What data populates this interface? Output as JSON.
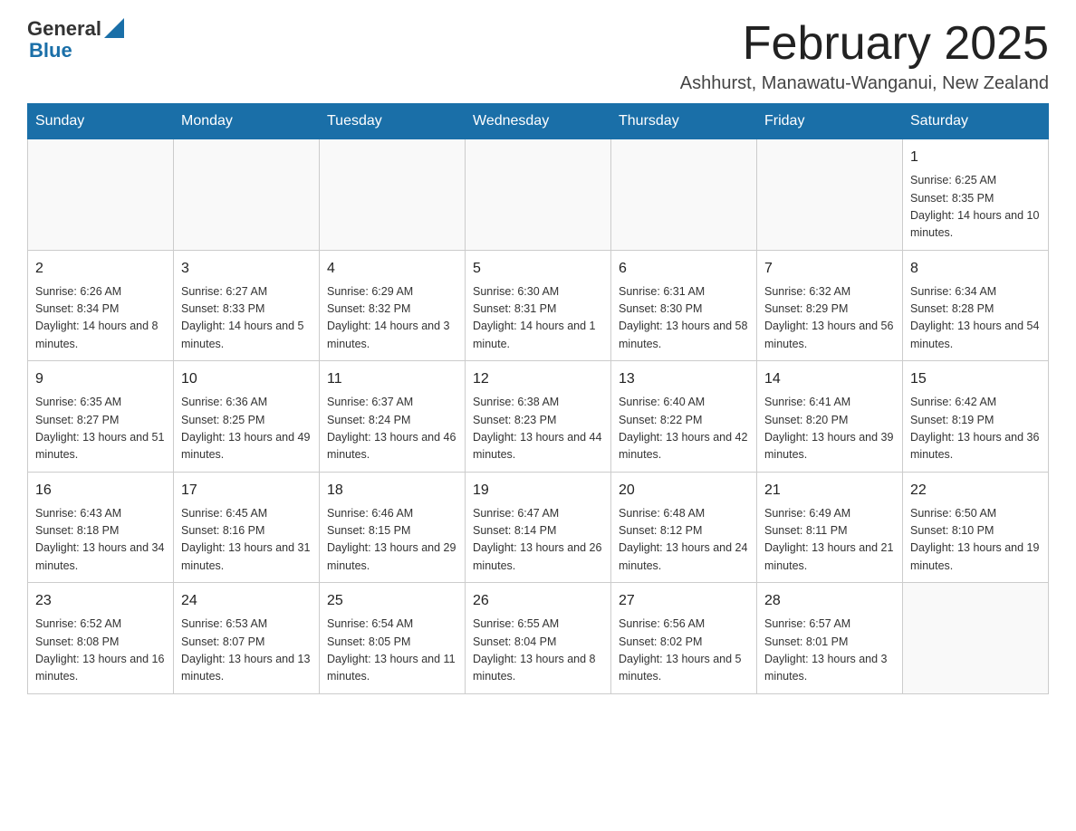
{
  "header": {
    "logo_general": "General",
    "logo_blue": "Blue",
    "title": "February 2025",
    "subtitle": "Ashhurst, Manawatu-Wanganui, New Zealand"
  },
  "days_of_week": [
    "Sunday",
    "Monday",
    "Tuesday",
    "Wednesday",
    "Thursday",
    "Friday",
    "Saturday"
  ],
  "weeks": [
    [
      {
        "day": "",
        "info": ""
      },
      {
        "day": "",
        "info": ""
      },
      {
        "day": "",
        "info": ""
      },
      {
        "day": "",
        "info": ""
      },
      {
        "day": "",
        "info": ""
      },
      {
        "day": "",
        "info": ""
      },
      {
        "day": "1",
        "info": "Sunrise: 6:25 AM\nSunset: 8:35 PM\nDaylight: 14 hours and 10 minutes."
      }
    ],
    [
      {
        "day": "2",
        "info": "Sunrise: 6:26 AM\nSunset: 8:34 PM\nDaylight: 14 hours and 8 minutes."
      },
      {
        "day": "3",
        "info": "Sunrise: 6:27 AM\nSunset: 8:33 PM\nDaylight: 14 hours and 5 minutes."
      },
      {
        "day": "4",
        "info": "Sunrise: 6:29 AM\nSunset: 8:32 PM\nDaylight: 14 hours and 3 minutes."
      },
      {
        "day": "5",
        "info": "Sunrise: 6:30 AM\nSunset: 8:31 PM\nDaylight: 14 hours and 1 minute."
      },
      {
        "day": "6",
        "info": "Sunrise: 6:31 AM\nSunset: 8:30 PM\nDaylight: 13 hours and 58 minutes."
      },
      {
        "day": "7",
        "info": "Sunrise: 6:32 AM\nSunset: 8:29 PM\nDaylight: 13 hours and 56 minutes."
      },
      {
        "day": "8",
        "info": "Sunrise: 6:34 AM\nSunset: 8:28 PM\nDaylight: 13 hours and 54 minutes."
      }
    ],
    [
      {
        "day": "9",
        "info": "Sunrise: 6:35 AM\nSunset: 8:27 PM\nDaylight: 13 hours and 51 minutes."
      },
      {
        "day": "10",
        "info": "Sunrise: 6:36 AM\nSunset: 8:25 PM\nDaylight: 13 hours and 49 minutes."
      },
      {
        "day": "11",
        "info": "Sunrise: 6:37 AM\nSunset: 8:24 PM\nDaylight: 13 hours and 46 minutes."
      },
      {
        "day": "12",
        "info": "Sunrise: 6:38 AM\nSunset: 8:23 PM\nDaylight: 13 hours and 44 minutes."
      },
      {
        "day": "13",
        "info": "Sunrise: 6:40 AM\nSunset: 8:22 PM\nDaylight: 13 hours and 42 minutes."
      },
      {
        "day": "14",
        "info": "Sunrise: 6:41 AM\nSunset: 8:20 PM\nDaylight: 13 hours and 39 minutes."
      },
      {
        "day": "15",
        "info": "Sunrise: 6:42 AM\nSunset: 8:19 PM\nDaylight: 13 hours and 36 minutes."
      }
    ],
    [
      {
        "day": "16",
        "info": "Sunrise: 6:43 AM\nSunset: 8:18 PM\nDaylight: 13 hours and 34 minutes."
      },
      {
        "day": "17",
        "info": "Sunrise: 6:45 AM\nSunset: 8:16 PM\nDaylight: 13 hours and 31 minutes."
      },
      {
        "day": "18",
        "info": "Sunrise: 6:46 AM\nSunset: 8:15 PM\nDaylight: 13 hours and 29 minutes."
      },
      {
        "day": "19",
        "info": "Sunrise: 6:47 AM\nSunset: 8:14 PM\nDaylight: 13 hours and 26 minutes."
      },
      {
        "day": "20",
        "info": "Sunrise: 6:48 AM\nSunset: 8:12 PM\nDaylight: 13 hours and 24 minutes."
      },
      {
        "day": "21",
        "info": "Sunrise: 6:49 AM\nSunset: 8:11 PM\nDaylight: 13 hours and 21 minutes."
      },
      {
        "day": "22",
        "info": "Sunrise: 6:50 AM\nSunset: 8:10 PM\nDaylight: 13 hours and 19 minutes."
      }
    ],
    [
      {
        "day": "23",
        "info": "Sunrise: 6:52 AM\nSunset: 8:08 PM\nDaylight: 13 hours and 16 minutes."
      },
      {
        "day": "24",
        "info": "Sunrise: 6:53 AM\nSunset: 8:07 PM\nDaylight: 13 hours and 13 minutes."
      },
      {
        "day": "25",
        "info": "Sunrise: 6:54 AM\nSunset: 8:05 PM\nDaylight: 13 hours and 11 minutes."
      },
      {
        "day": "26",
        "info": "Sunrise: 6:55 AM\nSunset: 8:04 PM\nDaylight: 13 hours and 8 minutes."
      },
      {
        "day": "27",
        "info": "Sunrise: 6:56 AM\nSunset: 8:02 PM\nDaylight: 13 hours and 5 minutes."
      },
      {
        "day": "28",
        "info": "Sunrise: 6:57 AM\nSunset: 8:01 PM\nDaylight: 13 hours and 3 minutes."
      },
      {
        "day": "",
        "info": ""
      }
    ]
  ]
}
